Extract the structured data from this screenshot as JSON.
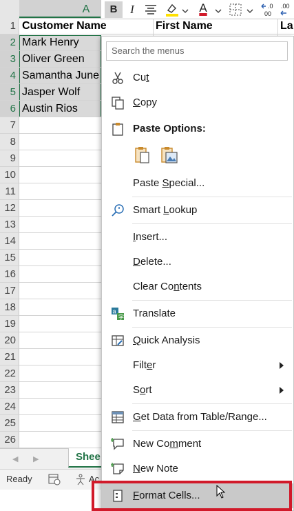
{
  "column_header": {
    "label": "A"
  },
  "grid": {
    "row_numbers": [
      "1",
      "2",
      "3",
      "4",
      "5",
      "6",
      "7",
      "8",
      "9",
      "10",
      "11",
      "12",
      "13",
      "14",
      "15",
      "16",
      "17",
      "18",
      "19",
      "20",
      "21",
      "22",
      "23",
      "24",
      "25",
      "26"
    ],
    "header_cells": [
      "Customer Name",
      "First Name",
      "La"
    ],
    "names": [
      "Mark Henry",
      "Oliver Green",
      "Samantha June",
      "Jasper Wolf",
      "Austin Rios"
    ]
  },
  "mini_toolbar": {
    "bold": "B",
    "italic": "I",
    "font_color": "A",
    "increase_decimal": ".00",
    "decrease_decimal": ".0"
  },
  "sheet_tab": {
    "label": "Shee"
  },
  "status_bar": {
    "ready": "Ready",
    "accessibility": "Ac"
  },
  "context_menu": {
    "search_placeholder": "Search the menus",
    "cut": "Cut",
    "copy": "Copy",
    "paste_options": "Paste Options:",
    "paste_special": "Paste Special...",
    "smart_lookup": "Smart Lookup",
    "insert": "Insert...",
    "delete": "Delete...",
    "clear_contents": "Clear Contents",
    "translate": "Translate",
    "quick_analysis": "Quick Analysis",
    "filter": "Filter",
    "sort": "Sort",
    "get_data": "Get Data from Table/Range...",
    "new_comment": "New Comment",
    "new_note": "New Note",
    "format_cells": "Format Cells..."
  },
  "colors": {
    "excel_green": "#217346",
    "highlight_red": "#d11a2a",
    "selection_gray": "#d9d9d9"
  }
}
